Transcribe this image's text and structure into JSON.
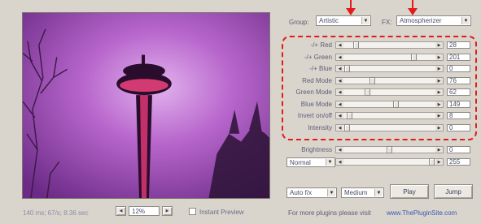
{
  "group": {
    "label": "Group:",
    "value": "Artistic"
  },
  "fx": {
    "label": "FX:",
    "value": "Atmospherizer"
  },
  "sliders": [
    {
      "label": "-/+ Red",
      "value": "28",
      "level": 0.11
    },
    {
      "label": "-/+ Green",
      "value": "201",
      "level": 0.79
    },
    {
      "label": "-/+ Blue",
      "value": "0",
      "level": 0.0
    },
    {
      "label": "Red Mode",
      "value": "76",
      "level": 0.3
    },
    {
      "label": "Green Mode",
      "value": "62",
      "level": 0.24
    },
    {
      "label": "Blue Mode",
      "value": "149",
      "level": 0.58
    },
    {
      "label": "Invert on/off",
      "value": "8",
      "level": 0.03
    },
    {
      "label": "Intensity",
      "value": "0",
      "level": 0.0
    }
  ],
  "brightness": {
    "label": "Brightness",
    "value": "0",
    "level": 0.5
  },
  "blend": {
    "mode": "Normal",
    "value": "255",
    "level": 1.0
  },
  "controls": {
    "auto": "Auto f/x",
    "speed": "Medium",
    "play": "Play",
    "jump": "Jump"
  },
  "status": "140 ms; 67/s; 8.36 sec",
  "zoom": "12%",
  "instant_preview": "Instant Preview",
  "footer": {
    "text": "For more plugins please visit",
    "link": "www.ThePluginSite.com"
  },
  "colors": {
    "highlight": "#e31b1b",
    "link": "#3c58b4"
  }
}
